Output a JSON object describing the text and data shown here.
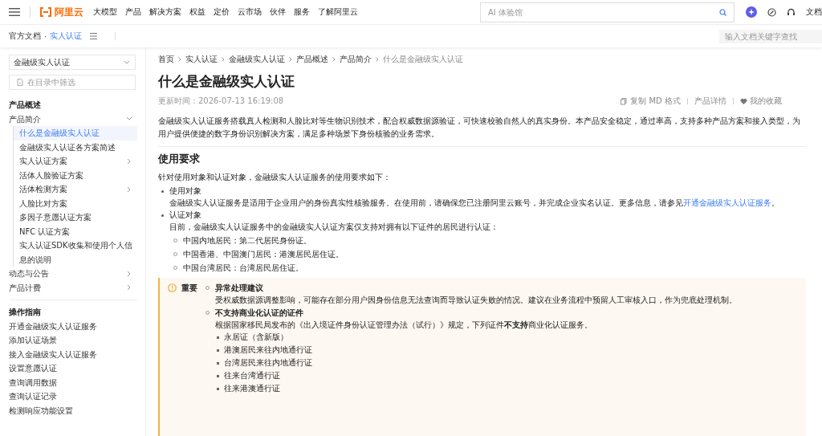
{
  "top_nav": {
    "logo": "阿里云",
    "links": [
      "大模型",
      "产品",
      "解决方案",
      "权益",
      "定价",
      "云市场",
      "伙伴",
      "服务",
      "了解阿里云"
    ],
    "search": {
      "placeholder": "AI 体验馆"
    },
    "docs_label": "文档"
  },
  "sub_nav": {
    "separator": "·",
    "crumbs": [
      {
        "label": "官方文档",
        "current": false
      },
      {
        "label": "实人认证",
        "current": true
      }
    ],
    "search": {
      "placeholder": "输入文档关键字查找"
    }
  },
  "sidebar": {
    "product_select": "金融级实人认证",
    "filter": {
      "placeholder": "在目录中筛选"
    },
    "sections": [
      {
        "title": "产品概述",
        "items": [
          {
            "label": "产品简介",
            "kind": "folder",
            "expanded": true,
            "selected": false,
            "children": [
              {
                "label": "什么是金融级实人认证",
                "kind": "leaf",
                "selected": true
              },
              {
                "label": "金融级实人认证各方案简述",
                "kind": "leaf",
                "selected": false
              },
              {
                "label": "实人认证方案",
                "kind": "folder",
                "expanded": false,
                "selected": false
              },
              {
                "label": "活体人脸验证方案",
                "kind": "leaf",
                "selected": false
              },
              {
                "label": "活体检测方案",
                "kind": "folder",
                "expanded": false,
                "selected": false
              },
              {
                "label": "人脸比对方案",
                "kind": "leaf",
                "selected": false
              },
              {
                "label": "多因子意愿认证方案",
                "kind": "leaf",
                "selected": false
              },
              {
                "label": "NFC 认证方案",
                "kind": "leaf",
                "selected": false
              },
              {
                "label": "实人认证SDK收集和使用个人信息的说明",
                "kind": "leaf",
                "selected": false
              }
            ]
          },
          {
            "label": "动态与公告",
            "kind": "folder",
            "expanded": false,
            "selected": false
          },
          {
            "label": "产品计费",
            "kind": "folder",
            "expanded": false,
            "selected": false
          }
        ]
      },
      {
        "title": "操作指南",
        "items": [
          {
            "label": "开通金融级实人认证服务",
            "kind": "leaf",
            "selected": false
          },
          {
            "label": "添加认证场景",
            "kind": "leaf",
            "selected": false
          },
          {
            "label": "接入金融级实人认证服务",
            "kind": "leaf",
            "selected": false
          },
          {
            "label": "设置意愿认证",
            "kind": "leaf",
            "selected": false
          },
          {
            "label": "查询调用数据",
            "kind": "leaf",
            "selected": false
          },
          {
            "label": "查询认证记录",
            "kind": "leaf",
            "selected": false
          },
          {
            "label": "检测响应功能设置",
            "kind": "leaf",
            "selected": false
          }
        ]
      }
    ]
  },
  "article": {
    "breadcrumb": [
      "首页",
      "实人认证",
      "金融级实人认证",
      "产品概述",
      "产品简介",
      "什么是金融级实人认证"
    ],
    "title": "什么是金融级实人认证",
    "updated": "更新时间：2026-07-13 16:19:08",
    "actions": [
      {
        "kind": "copy",
        "label": "复制 MD 格式"
      },
      {
        "kind": "detail",
        "label": "产品详情"
      },
      {
        "kind": "favorite",
        "label": "我的收藏"
      }
    ],
    "intro": "金融级实人认证服务搭载真人检测和人脸比对等生物识别技术，配合权威数据源验证，可快速校验自然人的真实身份。本产品安全稳定，通过率高，支持多种产品方案和接入类型，为用户提供便捷的数字身份识别解决方案，满足多种场景下身份核验的业务需求。",
    "section": {
      "heading": "使用要求",
      "lead": "针对使用对象和认证对象，金融级实人认证服务的使用要求如下：",
      "items": [
        {
          "title": "使用对象",
          "body": "金融级实人认证服务是适用于企业用户的身份真实性核验服务。在使用前，请确保您已注册阿里云账号，并完成企业实名认证。更多信息，请参见",
          "link": "开通金融级实人认证服务",
          "after": "。"
        },
        {
          "title": "认证对象",
          "body": "目前，金融级实人认证服务中的金融级实人认证方案仅支持对拥有以下证件的居民进行认证：",
          "list": [
            "中国内地居民：第二代居民身份证。",
            "中国香港、中国澳门居民：港澳居民居住证。",
            "中国台湾居民：台湾居民居住证。"
          ]
        }
      ]
    },
    "callout": {
      "label": "重要",
      "items": [
        {
          "title": "异常处理建议",
          "body": "受权威数据源调整影响，可能存在部分用户因身份信息无法查询而导致认证失败的情况。建议在业务流程中预留人工审核入口，作为兜底处理机制。"
        },
        {
          "title": "不支持商业化认证的证件",
          "body": "根据国家移民局发布的《出入境证件身份认证管理办法（试行）》规定，下列证件**不支持**商业化认证服务。",
          "list": [
            "永居证（含新版）",
            "港澳居民来往内地通行证",
            "台湾居民来往内地通行证",
            "往来台湾通行证",
            "往来港澳通行证"
          ]
        }
      ]
    }
  }
}
